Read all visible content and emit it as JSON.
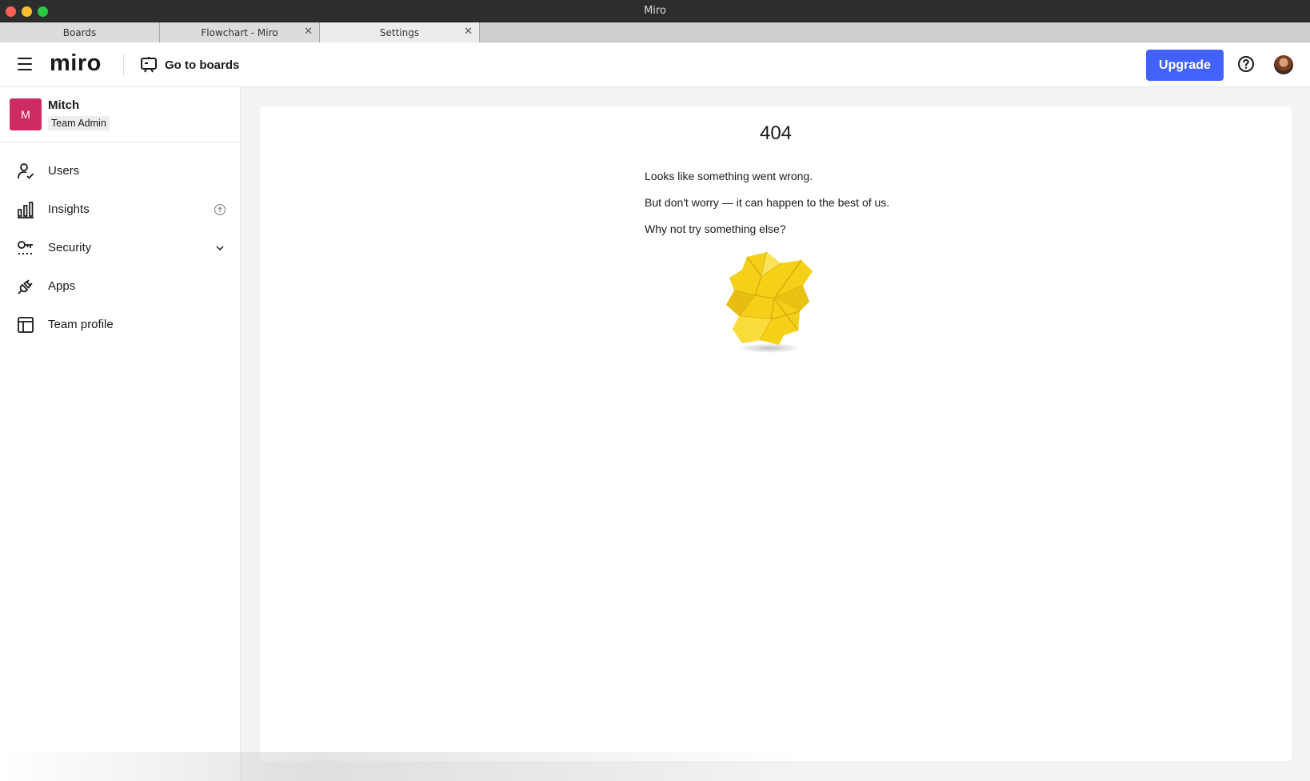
{
  "window": {
    "title": "Miro"
  },
  "tabs": [
    {
      "label": "Boards",
      "closable": false,
      "active": false
    },
    {
      "label": "Flowchart - Miro",
      "closable": true,
      "active": false
    },
    {
      "label": "Settings",
      "closable": true,
      "active": true
    }
  ],
  "header": {
    "logo": "miro",
    "go_to_boards": "Go to boards",
    "upgrade_label": "Upgrade",
    "accent_color": "#4262ff"
  },
  "team": {
    "avatar_letter": "M",
    "name": "Mitch",
    "role": "Team Admin",
    "avatar_color": "#cc2b63"
  },
  "sidebar": {
    "items": [
      {
        "label": "Users",
        "icon": "user-check-icon"
      },
      {
        "label": "Insights",
        "icon": "bar-chart-icon",
        "extra": "upgrade-badge-icon"
      },
      {
        "label": "Security",
        "icon": "key-icon",
        "extra": "chevron-down-icon"
      },
      {
        "label": "Apps",
        "icon": "plug-icon"
      },
      {
        "label": "Team profile",
        "icon": "layout-icon"
      }
    ]
  },
  "error": {
    "code": "404",
    "line1": "Looks like something went wrong.",
    "line2": "But don't worry — it can happen to the best of us.",
    "line3": "Why not try something else?",
    "illustration": "crumpled-paper-illustration"
  }
}
